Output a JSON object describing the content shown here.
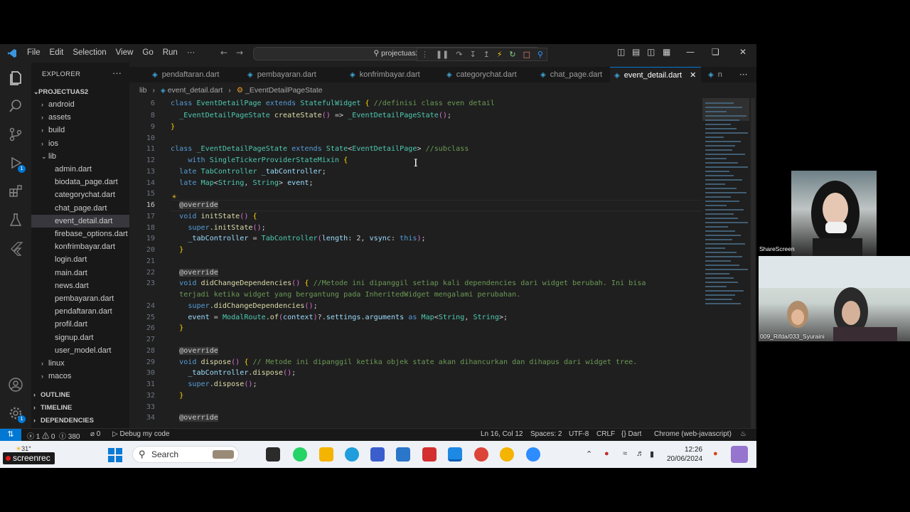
{
  "titlebar": {
    "menus": [
      "File",
      "Edit",
      "Selection",
      "View",
      "Go",
      "Run",
      "···"
    ],
    "search": "projectuas2"
  },
  "sidebar": {
    "title": "EXPLORER",
    "project": "PROJECTUAS2",
    "items": [
      {
        "label": "android",
        "type": "folder",
        "depth": 1
      },
      {
        "label": "assets",
        "type": "folder",
        "depth": 1
      },
      {
        "label": "build",
        "type": "folder",
        "depth": 1
      },
      {
        "label": "ios",
        "type": "folder",
        "depth": 1
      },
      {
        "label": "lib",
        "type": "folder-open",
        "depth": 1
      },
      {
        "label": "admin.dart",
        "type": "file",
        "depth": 2
      },
      {
        "label": "biodata_page.dart",
        "type": "file",
        "depth": 2
      },
      {
        "label": "categorychat.dart",
        "type": "file",
        "depth": 2
      },
      {
        "label": "chat_page.dart",
        "type": "file",
        "depth": 2
      },
      {
        "label": "event_detail.dart",
        "type": "file",
        "depth": 2,
        "selected": true
      },
      {
        "label": "firebase_options.dart",
        "type": "file",
        "depth": 2
      },
      {
        "label": "konfrimbayar.dart",
        "type": "file",
        "depth": 2
      },
      {
        "label": "login.dart",
        "type": "file",
        "depth": 2
      },
      {
        "label": "main.dart",
        "type": "file",
        "depth": 2
      },
      {
        "label": "news.dart",
        "type": "file",
        "depth": 2
      },
      {
        "label": "pembayaran.dart",
        "type": "file",
        "depth": 2
      },
      {
        "label": "pendaftaran.dart",
        "type": "file",
        "depth": 2
      },
      {
        "label": "profil.dart",
        "type": "file",
        "depth": 2
      },
      {
        "label": "signup.dart",
        "type": "file",
        "depth": 2
      },
      {
        "label": "user_model.dart",
        "type": "file",
        "depth": 2
      },
      {
        "label": "linux",
        "type": "folder",
        "depth": 1
      },
      {
        "label": "macos",
        "type": "folder",
        "depth": 1
      }
    ],
    "sections": [
      "OUTLINE",
      "TIMELINE",
      "DEPENDENCIES"
    ]
  },
  "tabs": [
    {
      "label": "pendaftaran.dart"
    },
    {
      "label": "pembayaran.dart"
    },
    {
      "label": "konfrimbayar.dart"
    },
    {
      "label": "categorychat.dart"
    },
    {
      "label": "chat_page.dart"
    },
    {
      "label": "event_detail.dart",
      "active": true
    },
    {
      "label": "n"
    }
  ],
  "breadcrumb": [
    "lib",
    "event_detail.dart",
    "_EventDetailPageState"
  ],
  "editor": {
    "lines": [
      {
        "n": "6",
        "code": "class EventDetailPage extends StatefulWidget { //definisi class even detail"
      },
      {
        "n": "8",
        "code": "  _EventDetailPageState createState() => _EventDetailPageState();"
      },
      {
        "n": "9",
        "code": "}"
      },
      {
        "n": "10",
        "code": ""
      },
      {
        "n": "11",
        "code": "class _EventDetailPageState extends State<EventDetailPage> //subclass"
      },
      {
        "n": "12",
        "code": "    with SingleTickerProviderStateMixin {"
      },
      {
        "n": "13",
        "code": "  late TabController _tabController;"
      },
      {
        "n": "14",
        "code": "  late Map<String, String> event;"
      },
      {
        "n": "15",
        "code": ""
      },
      {
        "n": "16",
        "code": "  @override"
      },
      {
        "n": "17",
        "code": "  void initState() {"
      },
      {
        "n": "18",
        "code": "    super.initState();"
      },
      {
        "n": "19",
        "code": "    _tabController = TabController(length: 2, vsync: this);"
      },
      {
        "n": "20",
        "code": "  }"
      },
      {
        "n": "21",
        "code": ""
      },
      {
        "n": "22",
        "code": "  @override"
      },
      {
        "n": "23",
        "code": "  void didChangeDependencies() { //Metode ini dipanggil setiap kali dependencies dari widget berubah. Ini bisa"
      },
      {
        "n": "",
        "code": "  terjadi ketika widget yang bergantung pada InheritedWidget mengalami perubahan."
      },
      {
        "n": "24",
        "code": "    super.didChangeDependencies();"
      },
      {
        "n": "25",
        "code": "    event = ModalRoute.of(context)?.settings.arguments as Map<String, String>;"
      },
      {
        "n": "26",
        "code": "  }"
      },
      {
        "n": "27",
        "code": ""
      },
      {
        "n": "28",
        "code": "  @override"
      },
      {
        "n": "29",
        "code": "  void dispose() { // Metode ini dipanggil ketika objek state akan dihancurkan dan dihapus dari widget tree."
      },
      {
        "n": "30",
        "code": "    _tabController.dispose();"
      },
      {
        "n": "31",
        "code": "    super.dispose();"
      },
      {
        "n": "32",
        "code": "  }"
      },
      {
        "n": "33",
        "code": ""
      },
      {
        "n": "34",
        "code": "  @override"
      }
    ],
    "sticky_partial": "  @override"
  },
  "statusbar": {
    "problems": "ⓧ 1 ⚠ 0",
    "ports": "Ⓘ 380",
    "radio": "⌀ 0",
    "debug": "Debug my code",
    "position": "Ln 16, Col 12",
    "spaces": "Spaces: 2",
    "encoding": "UTF-8",
    "eol": "CRLF",
    "language": "{} Dart",
    "device": "Chrome (web-javascript)"
  },
  "taskbar": {
    "weather": "31°",
    "search_placeholder": "Search",
    "time": "12:26",
    "date": "20/06/2024",
    "recorder": "screenrec"
  },
  "video": {
    "top_label": "ShareScreen",
    "bottom_label": "009_Rifda/033_Syuraini"
  },
  "colors": {
    "accent": "#0078d4",
    "editor_bg": "#1f1f1f",
    "sidebar_bg": "#181818",
    "keyword": "#569cd6",
    "type": "#4ec9b0",
    "comment": "#6a9955"
  }
}
